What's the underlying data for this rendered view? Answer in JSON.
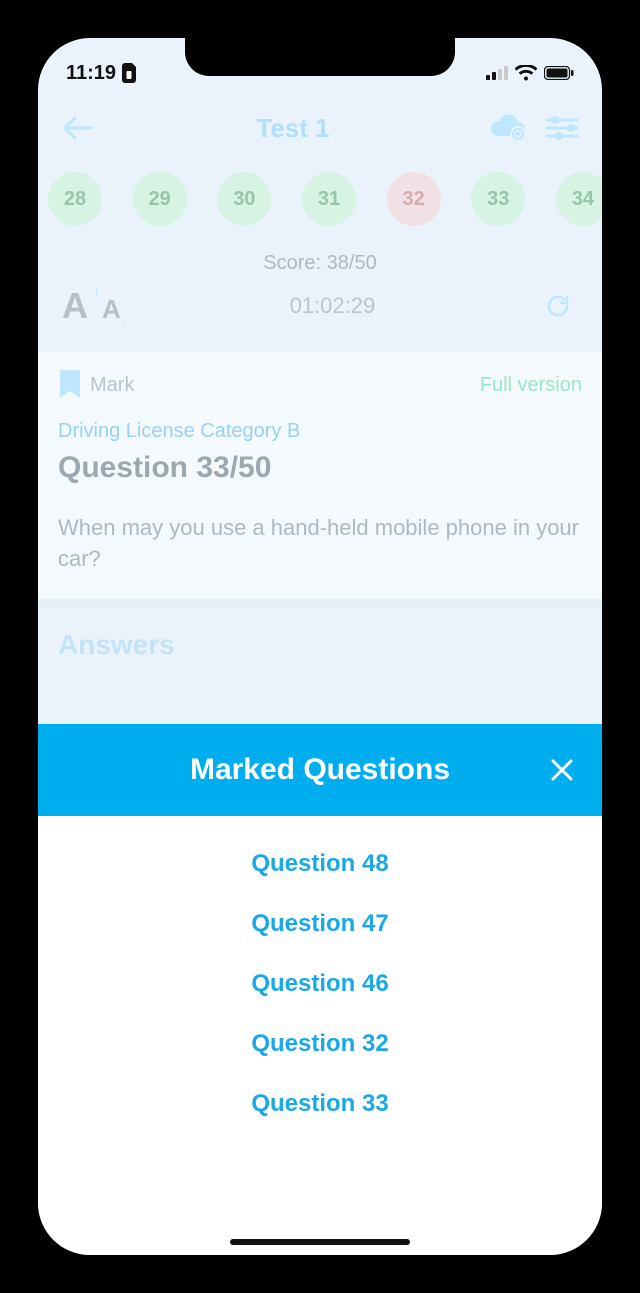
{
  "status": {
    "time": "11:19"
  },
  "header": {
    "title": "Test 1"
  },
  "qnav": [
    {
      "n": "28",
      "state": "ok"
    },
    {
      "n": "29",
      "state": "ok"
    },
    {
      "n": "30",
      "state": "ok"
    },
    {
      "n": "31",
      "state": "ok"
    },
    {
      "n": "32",
      "state": "bad"
    },
    {
      "n": "33",
      "state": "ok"
    },
    {
      "n": "34",
      "state": "ok"
    }
  ],
  "score_label": "Score: 38/50",
  "timer": "01:02:29",
  "mark_label": "Mark",
  "full_version_label": "Full version",
  "category": "Driving License Category B",
  "question_title": "Question 33/50",
  "question_text": "When may you use a hand-held mobile phone in your car?",
  "answers_heading": "Answers",
  "sheet": {
    "title": "Marked Questions",
    "items": [
      "Question 48",
      "Question 47",
      "Question 46",
      "Question 32",
      "Question 33"
    ]
  }
}
